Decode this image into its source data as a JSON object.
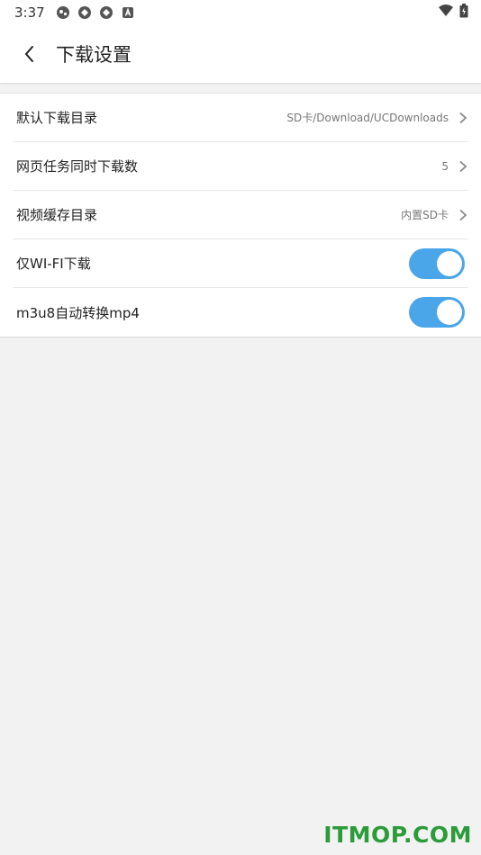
{
  "status_bar": {
    "time": "3:37",
    "left_icons": [
      "notification-icon",
      "sync-icon",
      "sync-icon",
      "app-icon"
    ],
    "right_icons": [
      "wifi-icon",
      "battery-icon"
    ]
  },
  "app_bar": {
    "title": "下载设置",
    "back_icon": "chevron-left-icon"
  },
  "settings": {
    "rows": [
      {
        "label": "默认下载目录",
        "value": "SD卡/Download/UCDownloads",
        "type": "nav"
      },
      {
        "label": "网页任务同时下载数",
        "value": "5",
        "type": "nav"
      },
      {
        "label": "视频缓存目录",
        "value": "内置SD卡",
        "type": "nav"
      },
      {
        "label": "仅WI-FI下载",
        "type": "toggle",
        "on": true
      },
      {
        "label": "m3u8自动转换mp4",
        "type": "toggle",
        "on": true
      }
    ]
  },
  "watermark": "ITMOP.COM",
  "colors": {
    "toggle_on": "#4aa6e8",
    "background": "#f2f2f2",
    "watermark": "#2c9b3a"
  }
}
